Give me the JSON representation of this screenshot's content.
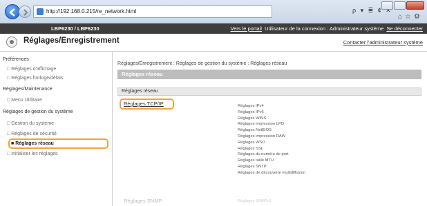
{
  "browser": {
    "url": "http://192.168.0.215/re_network.html",
    "address_tools": "ρ ▾ ≣ ¢ ✕"
  },
  "header": {
    "device_name": "LBP6230 / LBP6230",
    "link_portal": "Vers le portail",
    "user_label": "Utilisateur de la connexion : Administrateur système",
    "link_logout": "Se déconnecter"
  },
  "page": {
    "title": "Réglages/Enregistrement",
    "contact_admin": "Contacter l'administrateur système"
  },
  "sidebar": {
    "preferences_heading": "Préférences",
    "display_settings": "Réglages d'affichage",
    "timer_settings": "Réglages horloge/délais",
    "maintenance_heading": "Réglages/Maintenance",
    "utility_menu": "Menu Utilitaire",
    "system_mgmt_heading": "Réglages de gestion du système",
    "system_mgmt": "Gestion du système",
    "security_settings": "Réglages de sécurité",
    "network_settings": "Réglages réseau",
    "init_settings": "Initialiser les réglages"
  },
  "main": {
    "breadcrumb": "Réglages/Enregistrement : Réglages de gestion du système : Réglages réseau",
    "section_title": "Réglages réseau",
    "subsection": "Réglages réseau",
    "tcpip_link": "Réglages TCP/IP",
    "tcpip_items": [
      "Réglages IPv4",
      "Réglages IPv6",
      "Réglages WINS",
      "Réglages impression LPD",
      "Réglages NetBIOS",
      "Réglages impression RAW",
      "Réglages WSD",
      "Réglages SSL",
      "Réglages du numéro de port",
      "Réglages taille MTU",
      "Réglages SNTP",
      "Réglages de découverte multidiffusion"
    ],
    "snmp_link": "Réglages SNMP",
    "snmp_item": "Réglages SNMPv1"
  }
}
